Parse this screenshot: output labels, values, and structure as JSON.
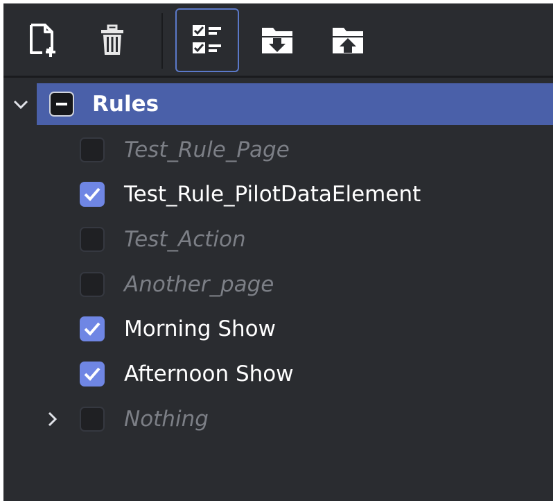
{
  "toolbar": {
    "buttons": [
      {
        "icon": "new-file-icon",
        "active": false
      },
      {
        "icon": "trash-icon",
        "active": false
      },
      {
        "icon": "checklist-icon",
        "active": true
      },
      {
        "icon": "folder-download-icon",
        "active": false
      },
      {
        "icon": "folder-upload-icon",
        "active": false
      }
    ]
  },
  "tree": {
    "root": {
      "label": "Rules",
      "expanded": true,
      "state": "partial"
    },
    "items": [
      {
        "label": "Test_Rule_Page",
        "checked": false,
        "enabled": false
      },
      {
        "label": "Test_Rule_PilotDataElement",
        "checked": true,
        "enabled": true
      },
      {
        "label": "Test_Action",
        "checked": false,
        "enabled": false
      },
      {
        "label": "Another_page",
        "checked": false,
        "enabled": false
      },
      {
        "label": "Morning Show",
        "checked": true,
        "enabled": true
      },
      {
        "label": "Afternoon Show",
        "checked": true,
        "enabled": true
      },
      {
        "label": "Nothing",
        "checked": false,
        "enabled": false,
        "has_children": true,
        "expanded": false
      }
    ]
  },
  "colors": {
    "panel_bg": "#2a2c30",
    "selection_bg": "#4a60a9",
    "checkbox_checked": "#6f86e4",
    "active_button_border": "#5b79c9",
    "disabled_text": "#7c7f86"
  }
}
